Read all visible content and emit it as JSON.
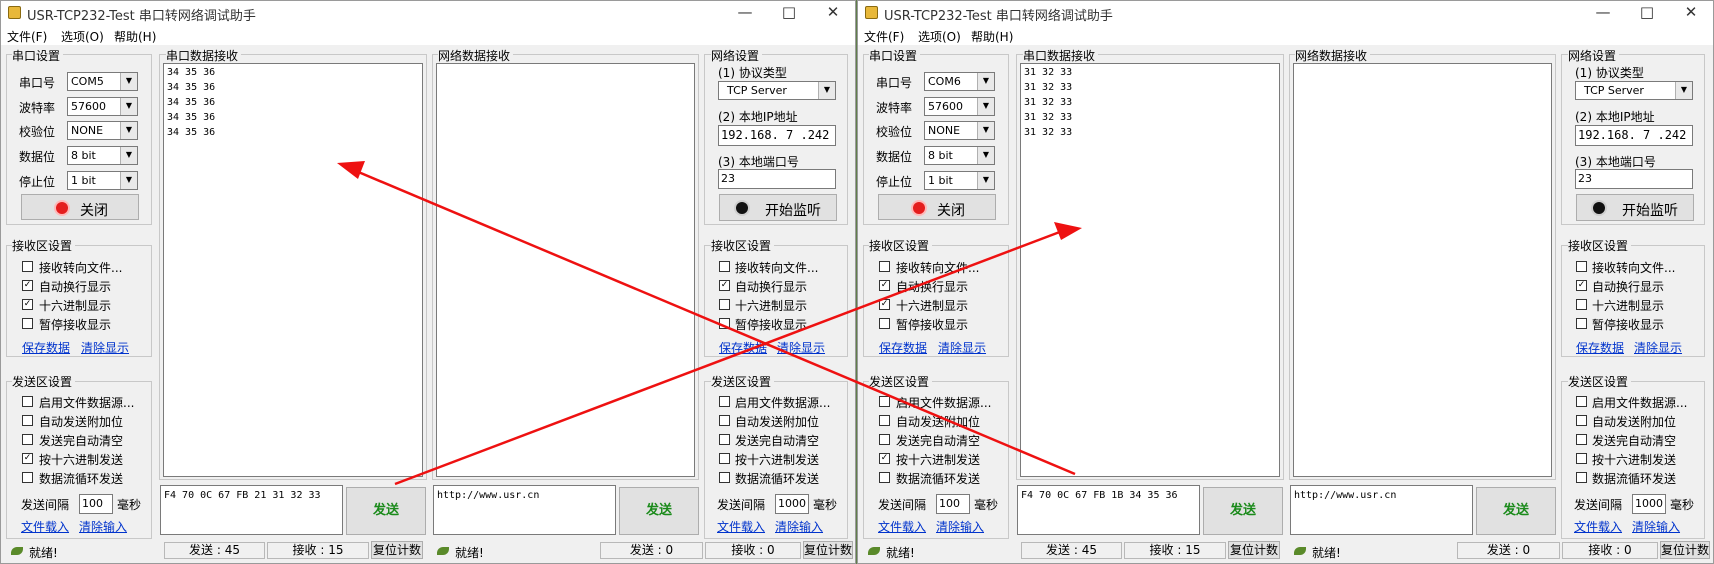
{
  "windows": [
    {
      "title": "USR-TCP232-Test 串口转网络调试助手",
      "menu": [
        "文件(F)",
        "选项(O)",
        "帮助(H)"
      ],
      "serial": {
        "group_title": "串口设置",
        "port_label": "串口号",
        "port": "COM5",
        "baud_label": "波特率",
        "baud": "57600",
        "parity_label": "校验位",
        "parity": "NONE",
        "databits_label": "数据位",
        "databits": "8 bit",
        "stopbits_label": "停止位",
        "stopbits": "1 bit",
        "close_button": "关闭"
      },
      "serial_receive": {
        "title": "串口数据接收",
        "lines": [
          "34 35 36",
          "34 35 36",
          "34 35 36",
          "34 35 36",
          "34 35 36"
        ]
      },
      "network_receive": {
        "title": "网络数据接收"
      },
      "recv_settings": {
        "title": "接收区设置",
        "options": [
          {
            "label": "接收转向文件...",
            "checked": false
          },
          {
            "label": "自动换行显示",
            "checked": true
          },
          {
            "label": "十六进制显示",
            "checked": true
          },
          {
            "label": "暂停接收显示",
            "checked": false
          }
        ],
        "save_link": "保存数据",
        "clear_link": "清除显示"
      },
      "send_settings": {
        "title": "发送区设置",
        "options": [
          {
            "label": "启用文件数据源...",
            "checked": false
          },
          {
            "label": "自动发送附加位",
            "checked": false
          },
          {
            "label": "发送完自动清空",
            "checked": false
          },
          {
            "label": "按十六进制发送",
            "checked": true
          },
          {
            "label": "数据流循环发送",
            "checked": false
          }
        ],
        "interval_label": "发送间隔",
        "interval": "100",
        "unit": "毫秒",
        "load_link": "文件载入",
        "clear_link": "清除输入"
      },
      "serial_send_text": "F4 70 0C 67 FB 21 31 32 33",
      "net_send_text": "http://www.usr.cn",
      "send_button": "发送",
      "net": {
        "group_title": "网络设置",
        "protocol_label": "(1) 协议类型",
        "protocol": "TCP Server",
        "ip_label": "(2) 本地IP地址",
        "ip": "192.168. 7 .242",
        "port_label": "(3) 本地端口号",
        "port": "23",
        "listen_button": "开始监听"
      },
      "net_recv_settings": {
        "title": "接收区设置",
        "options": [
          {
            "label": "接收转向文件...",
            "checked": false
          },
          {
            "label": "自动换行显示",
            "checked": true
          },
          {
            "label": "十六进制显示",
            "checked": false
          },
          {
            "label": "暂停接收显示",
            "checked": false
          }
        ],
        "save_link": "保存数据",
        "clear_link": "清除显示"
      },
      "net_send_settings": {
        "title": "发送区设置",
        "options": [
          {
            "label": "启用文件数据源...",
            "checked": false
          },
          {
            "label": "自动发送附加位",
            "checked": false
          },
          {
            "label": "发送完自动清空",
            "checked": false
          },
          {
            "label": "按十六进制发送",
            "checked": false
          },
          {
            "label": "数据流循环发送",
            "checked": false
          }
        ],
        "interval_label": "发送间隔",
        "interval": "1000",
        "unit": "毫秒",
        "load_link": "文件载入",
        "clear_link": "清除输入"
      },
      "status": {
        "ready": "就绪!",
        "send": "发送 : 45",
        "recv": "接收 : 15",
        "reset": "复位计数",
        "ready2": "就绪!",
        "send2": "发送 : 0",
        "recv2": "接收 : 0",
        "reset2": "复位计数"
      }
    },
    {
      "title": "USR-TCP232-Test 串口转网络调试助手",
      "menu": [
        "文件(F)",
        "选项(O)",
        "帮助(H)"
      ],
      "serial": {
        "group_title": "串口设置",
        "port_label": "串口号",
        "port": "COM6",
        "baud_label": "波特率",
        "baud": "57600",
        "parity_label": "校验位",
        "parity": "NONE",
        "databits_label": "数据位",
        "databits": "8 bit",
        "stopbits_label": "停止位",
        "stopbits": "1 bit",
        "close_button": "关闭"
      },
      "serial_receive": {
        "title": "串口数据接收",
        "lines": [
          "31 32 33",
          "31 32 33",
          "31 32 33",
          "31 32 33",
          "31 32 33"
        ]
      },
      "network_receive": {
        "title": "网络数据接收"
      },
      "recv_settings": {
        "title": "接收区设置",
        "options": [
          {
            "label": "接收转向文件...",
            "checked": false
          },
          {
            "label": "自动换行显示",
            "checked": true
          },
          {
            "label": "十六进制显示",
            "checked": true
          },
          {
            "label": "暂停接收显示",
            "checked": false
          }
        ],
        "save_link": "保存数据",
        "clear_link": "清除显示"
      },
      "send_settings": {
        "title": "发送区设置",
        "options": [
          {
            "label": "启用文件数据源...",
            "checked": false
          },
          {
            "label": "自动发送附加位",
            "checked": false
          },
          {
            "label": "发送完自动清空",
            "checked": false
          },
          {
            "label": "按十六进制发送",
            "checked": true
          },
          {
            "label": "数据流循环发送",
            "checked": false
          }
        ],
        "interval_label": "发送间隔",
        "interval": "100",
        "unit": "毫秒",
        "load_link": "文件载入",
        "clear_link": "清除输入"
      },
      "serial_send_text": "F4 70 0C 67 FB 1B 34 35 36",
      "net_send_text": "http://www.usr.cn",
      "send_button": "发送",
      "net": {
        "group_title": "网络设置",
        "protocol_label": "(1) 协议类型",
        "protocol": "TCP Server",
        "ip_label": "(2) 本地IP地址",
        "ip": "192.168. 7 .242",
        "port_label": "(3) 本地端口号",
        "port": "23",
        "listen_button": "开始监听"
      },
      "net_recv_settings": {
        "title": "接收区设置",
        "options": [
          {
            "label": "接收转向文件...",
            "checked": false
          },
          {
            "label": "自动换行显示",
            "checked": true
          },
          {
            "label": "十六进制显示",
            "checked": false
          },
          {
            "label": "暂停接收显示",
            "checked": false
          }
        ],
        "save_link": "保存数据",
        "clear_link": "清除显示"
      },
      "net_send_settings": {
        "title": "发送区设置",
        "options": [
          {
            "label": "启用文件数据源...",
            "checked": false
          },
          {
            "label": "自动发送附加位",
            "checked": false
          },
          {
            "label": "发送完自动清空",
            "checked": false
          },
          {
            "label": "按十六进制发送",
            "checked": false
          },
          {
            "label": "数据流循环发送",
            "checked": false
          }
        ],
        "interval_label": "发送间隔",
        "interval": "1000",
        "unit": "毫秒",
        "load_link": "文件载入",
        "clear_link": "清除输入"
      },
      "status": {
        "ready": "就绪!",
        "send": "发送 : 45",
        "recv": "接收 : 15",
        "reset": "复位计数",
        "ready2": "就绪!",
        "send2": "发送 : 0",
        "recv2": "接收 : 0",
        "reset2": "复位计数"
      }
    }
  ],
  "annotation_color": "#ee1111"
}
